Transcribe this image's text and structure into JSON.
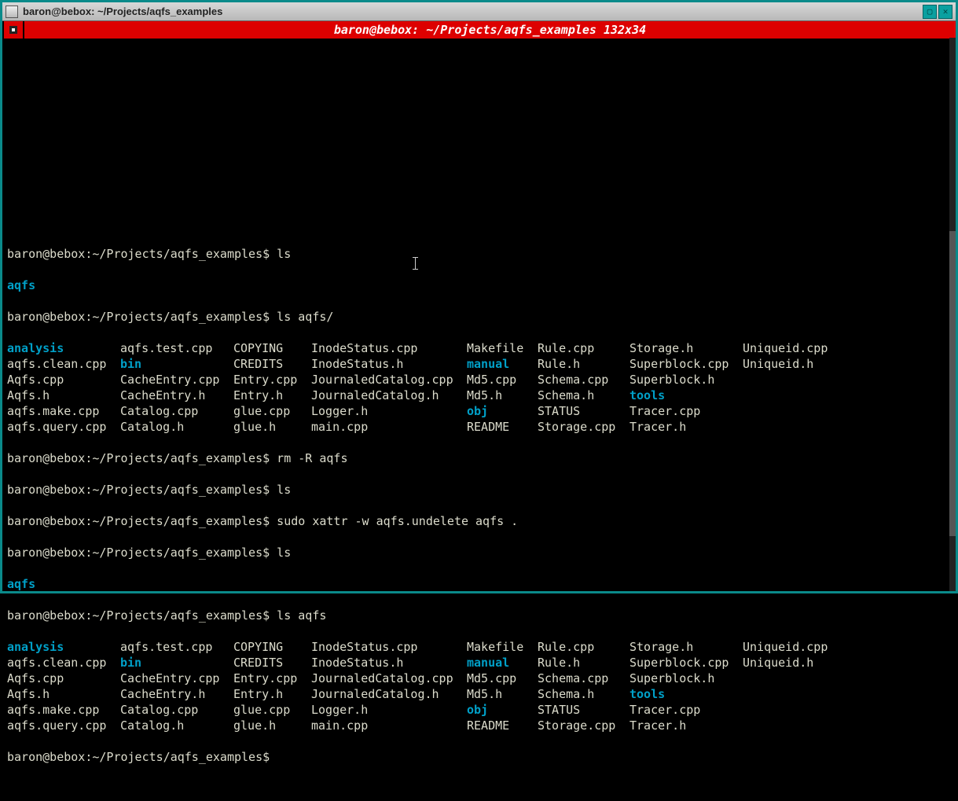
{
  "window": {
    "title": "baron@bebox: ~/Projects/aqfs_examples",
    "banner": "baron@bebox: ~/Projects/aqfs_examples 132x34"
  },
  "prompts": {
    "p1": "baron@bebox:~/Projects/aqfs_examples$ ls",
    "p2": "baron@bebox:~/Projects/aqfs_examples$ ls aqfs/",
    "p3": "baron@bebox:~/Projects/aqfs_examples$ rm -R aqfs",
    "p4": "baron@bebox:~/Projects/aqfs_examples$ ls",
    "p5": "baron@bebox:~/Projects/aqfs_examples$ sudo xattr -w aqfs.undelete aqfs .",
    "p6": "baron@bebox:~/Projects/aqfs_examples$ ls",
    "p7": "baron@bebox:~/Projects/aqfs_examples$ ls aqfs",
    "p8": "baron@bebox:~/Projects/aqfs_examples$ "
  },
  "single": {
    "aqfs1": "aqfs",
    "aqfs2": "aqfs"
  },
  "listing": {
    "col0": [
      "analysis",
      "aqfs.clean.cpp",
      "Aqfs.cpp",
      "Aqfs.h",
      "aqfs.make.cpp",
      "aqfs.query.cpp"
    ],
    "col1": [
      "aqfs.test.cpp",
      "bin",
      "CacheEntry.cpp",
      "CacheEntry.h",
      "Catalog.cpp",
      "Catalog.h"
    ],
    "col2": [
      "COPYING",
      "CREDITS",
      "Entry.cpp",
      "Entry.h",
      "glue.cpp",
      "glue.h"
    ],
    "col3": [
      "InodeStatus.cpp",
      "InodeStatus.h",
      "JournaledCatalog.cpp",
      "JournaledCatalog.h",
      "Logger.h",
      "main.cpp"
    ],
    "col4": [
      "Makefile",
      "manual",
      "Md5.cpp",
      "Md5.h",
      "obj",
      "README"
    ],
    "col5": [
      "Rule.cpp",
      "Rule.h",
      "Schema.cpp",
      "Schema.h",
      "STATUS",
      "Storage.cpp"
    ],
    "col6": [
      "Storage.h",
      "Superblock.cpp",
      "Superblock.h",
      "tools",
      "Tracer.cpp",
      "Tracer.h"
    ],
    "col7": [
      "Uniqueid.cpp",
      "Uniqueid.h"
    ],
    "dirs": [
      "analysis",
      "bin",
      "manual",
      "obj",
      "tools"
    ]
  }
}
